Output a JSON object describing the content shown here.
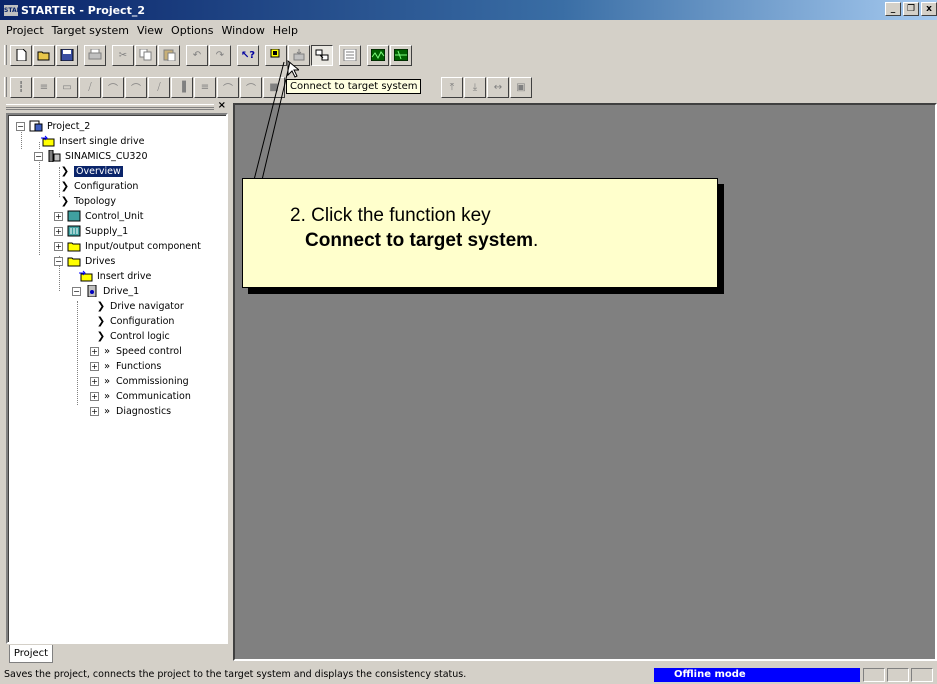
{
  "window": {
    "title": "STARTER - Project_2",
    "icon_text": "START"
  },
  "menu": {
    "items": [
      "Project",
      "Target system",
      "View",
      "Options",
      "Window",
      "Help"
    ]
  },
  "tooltip": "Connect to target system",
  "tree": {
    "project": "Project_2",
    "insert_single_drive": "Insert single drive",
    "device": "SINAMICS_CU320",
    "overview": "Overview",
    "configuration": "Configuration",
    "topology": "Topology",
    "control_unit": "Control_Unit",
    "supply": "Supply_1",
    "io_component": "Input/output component",
    "drives": "Drives",
    "insert_drive": "Insert drive",
    "drive": "Drive_1",
    "drive_navigator": "Drive navigator",
    "drive_configuration": "Configuration",
    "control_logic": "Control logic",
    "speed_control": "Speed control",
    "functions": "Functions",
    "commissioning": "Commissioning",
    "communication": "Communication",
    "diagnostics": "Diagnostics"
  },
  "tab_label": "Project",
  "callout": {
    "line1": "2. Click the function key",
    "line2_bold": "Connect to target system",
    "line2_end": "."
  },
  "status": {
    "text": "Saves the project, connects the project to the target system and displays the consistency status.",
    "mode": "Offline mode"
  },
  "colors": {
    "title_start": "#0a246a",
    "selection": "#0a246a",
    "callout_bg": "#ffffcc",
    "workspace_bg": "#808080",
    "offline_mode_bg": "#0000ff"
  }
}
